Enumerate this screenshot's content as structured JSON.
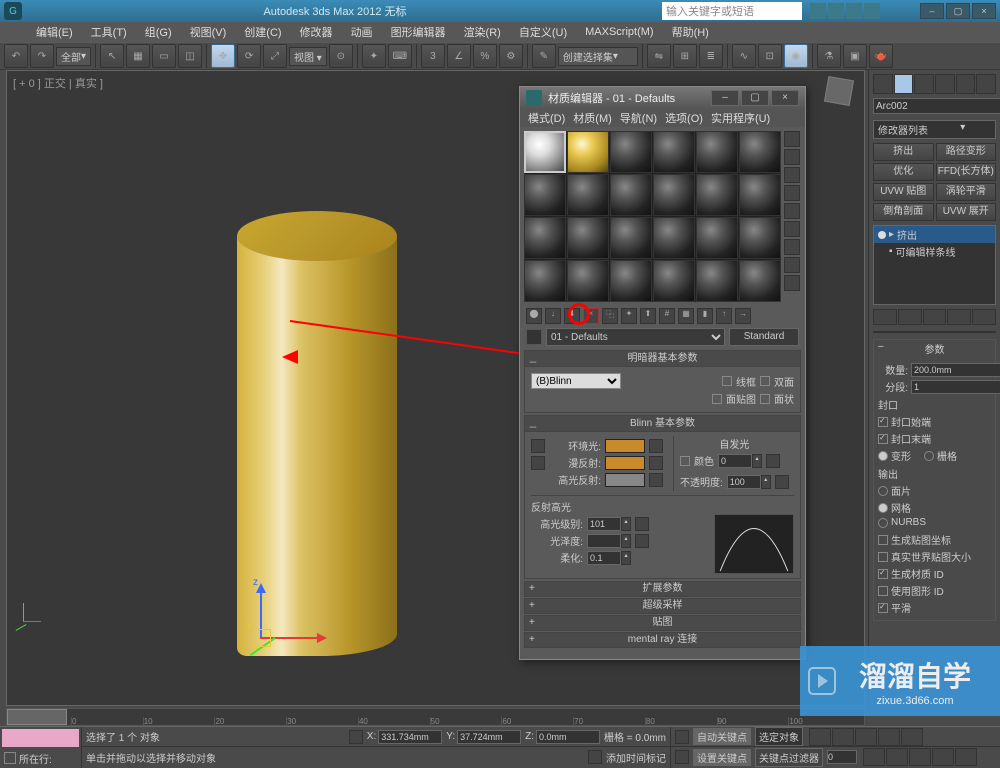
{
  "title": "Autodesk 3ds Max 2012      无标",
  "search_placeholder": "输入关键字或短语",
  "menu": [
    "编辑(E)",
    "工具(T)",
    "组(G)",
    "视图(V)",
    "创建(C)",
    "修改器",
    "动画",
    "图形编辑器",
    "渲染(R)",
    "自定义(U)",
    "MAXScript(M)",
    "帮助(H)"
  ],
  "selection_scope": "全部",
  "create_filter": "创建选择集",
  "viewport_label": "[ + 0 ] 正交 | 真实 ]",
  "mat_editor": {
    "title": "材质编辑器 - 01 - Defaults",
    "menu": [
      "模式(D)",
      "材质(M)",
      "导航(N)",
      "选项(O)",
      "实用程序(U)"
    ],
    "current_name": "01 - Defaults",
    "type": "Standard",
    "shader_rollout": "明暗器基本参数",
    "shader": "(B)Blinn",
    "wire": "线框",
    "two_sided": "双面",
    "face_map": "面贴图",
    "faceted": "面状",
    "blinn_rollout": "Blinn 基本参数",
    "ambient": "环境光:",
    "diffuse": "漫反射:",
    "specular_color": "高光反射:",
    "self_illum": "自发光",
    "color_lbl": "颜色",
    "color_val": "0",
    "opacity": "不透明度:",
    "opacity_val": "100",
    "spec_rollout": "反射高光",
    "spec_level": "高光级别:",
    "spec_level_val": "101",
    "gloss": "光泽度:",
    "gloss_val": "",
    "soften": "柔化:",
    "soften_val": "0.1",
    "rollouts": [
      "扩展参数",
      "超级采样",
      "贴图",
      "mental ray 连接"
    ]
  },
  "cmd": {
    "object_name": "Arc002",
    "mod_list_label": "修改器列表",
    "buttons": [
      "挤出",
      "路径变形",
      "优化",
      "FFD(长方体)",
      "UVW 贴图",
      "涡轮平滑",
      "倒角剖面",
      "UVW 展开"
    ],
    "stack": [
      "挤出",
      "可编辑样条线"
    ],
    "params_title": "参数",
    "amount": "数量:",
    "amount_val": "200.0mm",
    "segs": "分段:",
    "segs_val": "1",
    "cap_group": "封口",
    "cap_start": "封口始端",
    "cap_end": "封口末端",
    "morph": "变形",
    "grid": "栅格",
    "output_group": "输出",
    "patch": "面片",
    "mesh": "网格",
    "nurbs": "NURBS",
    "gen_map": "生成贴图坐标",
    "real_world": "真实世界贴图大小",
    "gen_mat_id": "生成材质 ID",
    "use_shape_id": "使用图形 ID",
    "smooth": "平滑"
  },
  "status": {
    "now_line": "所在行:",
    "sel_msg": "选择了 1 个 对象",
    "drag_hint": "单击并拖动以选择并移动对象",
    "x": "331.734mm",
    "y": "37.724mm",
    "z": "0.0mm",
    "grid": "栅格 = 0.0mm",
    "auto_key": "自动关键点",
    "sel_locked": "选定对象",
    "set_key": "设置关键点",
    "key_filter": "关键点过滤器",
    "add_time": "添加时间标记"
  },
  "watermark": {
    "big": "溜溜自学",
    "url": "zixue.3d66.com"
  },
  "timeline_ticks": [
    "0",
    "10",
    "20",
    "30",
    "40",
    "50",
    "60",
    "70",
    "80",
    "90",
    "100"
  ]
}
